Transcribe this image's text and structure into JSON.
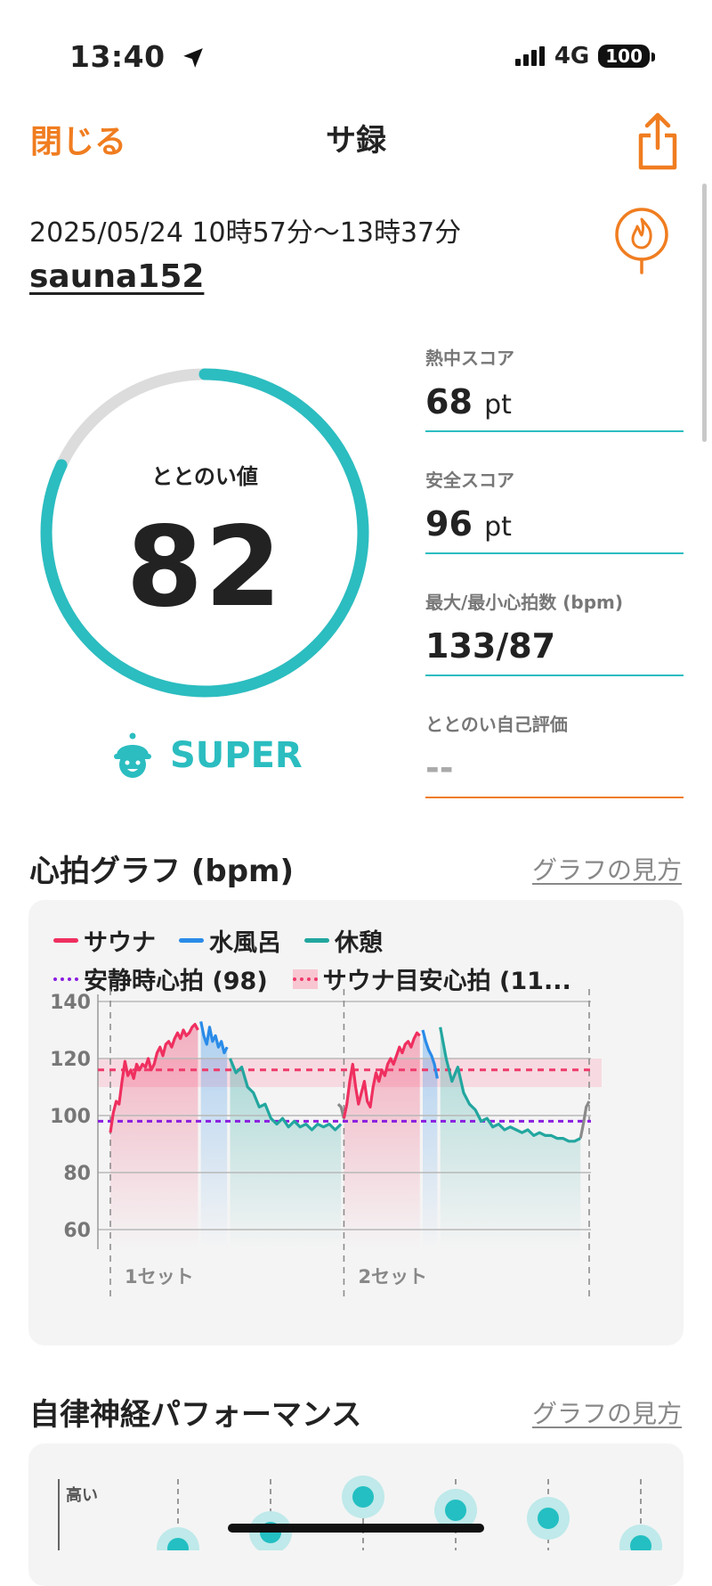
{
  "status": {
    "time": "13:40",
    "network": "4G",
    "battery": "100"
  },
  "nav": {
    "close": "閉じる",
    "title": "サ録"
  },
  "session": {
    "date": "2025/05/24 10時57分〜13時37分",
    "user": "sauna152"
  },
  "score": {
    "label": "ととのい値",
    "value": "82",
    "fraction": 0.82,
    "rank": "SUPER"
  },
  "stats": [
    {
      "label": "熱中スコア",
      "value": "68",
      "unit": "pt"
    },
    {
      "label": "安全スコア",
      "value": "96",
      "unit": "pt"
    },
    {
      "label": "最大/最小心拍数 (bpm)",
      "value": "133/87",
      "unit": ""
    },
    {
      "label": "ととのい自己評価",
      "value": "--",
      "unit": ""
    }
  ],
  "hr_section": {
    "title": "心拍グラフ (bpm)",
    "help": "グラフの見方"
  },
  "ans_section": {
    "title": "自律神経パフォーマンス",
    "help": "グラフの見方",
    "ylabel": "高い"
  },
  "colors": {
    "sauna": "#ef2f5f",
    "cold_bath": "#2a8be8",
    "rest": "#22a69f",
    "resting_hr": "#8a1de0",
    "target": "#ef3a6b",
    "accent": "#f07d20",
    "teal": "#2bbdc0"
  },
  "chart_data": {
    "type": "line",
    "legend": [
      "サウナ",
      "水風呂",
      "休憩",
      "安静時心拍 (98)",
      "サウナ目安心拍 (11..."
    ],
    "ylim": [
      60,
      140
    ],
    "yticks": [
      "140",
      "120",
      "100",
      "80",
      "60"
    ],
    "set_labels": [
      "1セット",
      "2セット"
    ],
    "resting_hr": 98,
    "target_hr": 116,
    "target_band": [
      110,
      120
    ],
    "series": [
      {
        "name": "サウナ",
        "segment": "sauna",
        "t": [
          0,
          1,
          2,
          3,
          4,
          5,
          6,
          7,
          8,
          9,
          10,
          11,
          12,
          13,
          14,
          15,
          16,
          17,
          18,
          19,
          20,
          21,
          22,
          23,
          24,
          25,
          26,
          27,
          28,
          29,
          30
        ],
        "values": [
          94,
          101,
          105,
          104,
          112,
          119,
          114,
          116,
          113,
          118,
          116,
          118,
          117,
          120,
          116,
          118,
          122,
          124,
          121,
          125,
          126,
          124,
          127,
          129,
          127,
          130,
          128,
          129,
          131,
          132,
          130
        ]
      },
      {
        "name": "水風呂",
        "segment": "cold",
        "t": [
          31,
          32,
          33,
          34,
          35,
          36,
          37,
          38,
          39,
          40
        ],
        "values": [
          133,
          128,
          125,
          131,
          126,
          128,
          124,
          126,
          122,
          124
        ]
      },
      {
        "name": "休憩",
        "segment": "rest",
        "t": [
          41,
          43,
          45,
          47,
          49,
          51,
          53,
          55,
          57,
          59,
          61,
          63,
          65,
          67,
          69,
          71,
          73,
          75,
          77,
          79
        ],
        "values": [
          120,
          115,
          117,
          110,
          108,
          103,
          104,
          99,
          97,
          99,
          96,
          98,
          96,
          97,
          95,
          97,
          96,
          97,
          95,
          97
        ]
      },
      {
        "name": "サウナ",
        "segment": "sauna",
        "t": [
          80,
          81,
          82,
          83,
          84,
          85,
          86,
          87,
          88,
          89,
          90,
          91,
          92,
          93,
          94,
          95,
          96,
          97,
          98,
          99,
          100,
          101,
          102,
          103,
          104,
          105,
          106
        ],
        "values": [
          99,
          104,
          112,
          118,
          110,
          104,
          108,
          112,
          105,
          103,
          110,
          115,
          112,
          116,
          114,
          118,
          120,
          118,
          121,
          124,
          122,
          125,
          126,
          124,
          127,
          129,
          128
        ]
      },
      {
        "name": "水風呂",
        "segment": "cold",
        "t": [
          107,
          108,
          109,
          110,
          111,
          112
        ],
        "values": [
          130,
          126,
          123,
          121,
          118,
          113
        ]
      },
      {
        "name": "休憩",
        "segment": "rest",
        "t": [
          113,
          115,
          117,
          119,
          121,
          123,
          125,
          127,
          129,
          131,
          133,
          135,
          137,
          139,
          141,
          143,
          145,
          147,
          149,
          151,
          153,
          155,
          157,
          159,
          161
        ],
        "values": [
          131,
          120,
          112,
          117,
          108,
          104,
          102,
          98,
          99,
          96,
          97,
          95,
          96,
          95,
          94,
          95,
          93,
          94,
          93,
          93,
          92,
          92,
          91,
          91,
          92
        ]
      }
    ],
    "transition": [
      {
        "t": [
          78,
          79,
          80
        ],
        "values": [
          104,
          103,
          99
        ]
      },
      {
        "t": [
          161,
          162,
          163,
          164
        ],
        "values": [
          92,
          97,
          103,
          105
        ]
      }
    ]
  }
}
